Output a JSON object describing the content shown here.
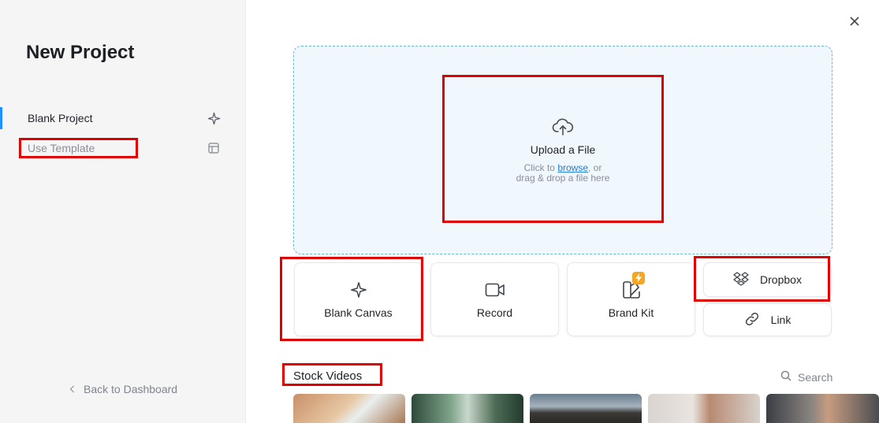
{
  "sidebar": {
    "title": "New Project",
    "items": [
      {
        "label": "Blank Project",
        "icon": "sparkle-icon"
      },
      {
        "label": "Use Template",
        "icon": "template-icon"
      }
    ],
    "back_label": "Back to Dashboard"
  },
  "upload": {
    "title": "Upload a File",
    "sub_prefix": "Click to ",
    "sub_link": "browse",
    "sub_suffix": ", or",
    "sub_line2": "drag & drop a file here"
  },
  "actions": {
    "blank_canvas": "Blank Canvas",
    "record": "Record",
    "brand_kit": "Brand Kit",
    "dropbox": "Dropbox",
    "link": "Link"
  },
  "stock": {
    "title": "Stock Videos",
    "search_label": "Search"
  },
  "colors": {
    "accent": "#1e90ff",
    "highlight": "#e00000",
    "badge": "#f5a623"
  }
}
